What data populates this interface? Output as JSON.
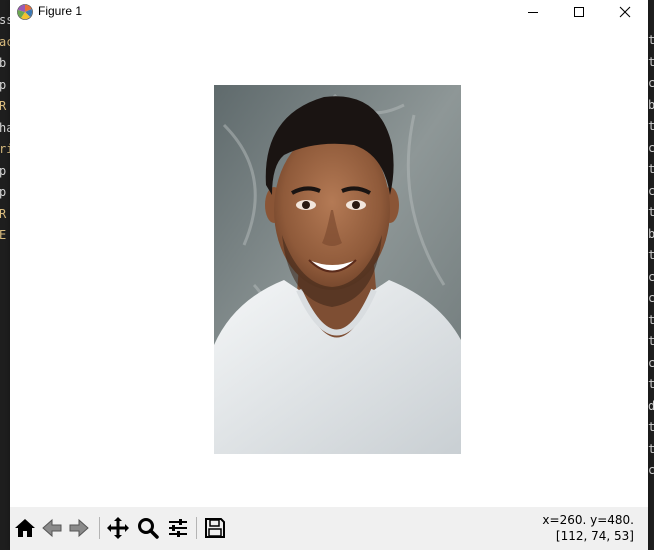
{
  "background_editor": {
    "left_fragments": [
      "ss",
      "ac",
      "b",
      "p",
      "R",
      "ha",
      "ri",
      "p",
      "p",
      "R",
      "E"
    ],
    "left_colors": [
      "#d4d4d4",
      "#d7ba7d",
      "#d4d4d4",
      "#d4d4d4",
      "#d7ba7d",
      "#d4d4d4",
      "#d7ba7d",
      "#d4d4d4",
      "#d4d4d4",
      "#d7ba7d",
      "#d7ba7d"
    ],
    "right_fragments": [
      "t",
      "t",
      "c",
      "b",
      "t",
      "c",
      "t",
      "c",
      "t",
      "b",
      "t",
      "c",
      "c",
      "t",
      "t",
      "c",
      "t",
      "d",
      "t",
      "t",
      "c"
    ]
  },
  "window": {
    "title": "Figure 1",
    "app_icon": "matplotlib-icon",
    "controls": [
      "minimize-icon",
      "maximize-icon",
      "close-icon"
    ]
  },
  "figure": {
    "image_description_icon": "portrait-photo"
  },
  "toolbar": {
    "buttons": [
      {
        "name": "home-icon"
      },
      {
        "name": "back-arrow-icon"
      },
      {
        "name": "forward-arrow-icon"
      },
      {
        "name": "pan-move-icon"
      },
      {
        "name": "zoom-magnifier-icon"
      },
      {
        "name": "configure-subplots-icon"
      },
      {
        "name": "save-floppy-icon"
      }
    ],
    "coords_line1": "x=260. y=480.",
    "coords_line2": "[112, 74, 53]"
  },
  "colors": {
    "toolbar_bg": "#f0f0f0",
    "window_bg": "#ffffff",
    "editor_bg": "#1e1e1e"
  }
}
